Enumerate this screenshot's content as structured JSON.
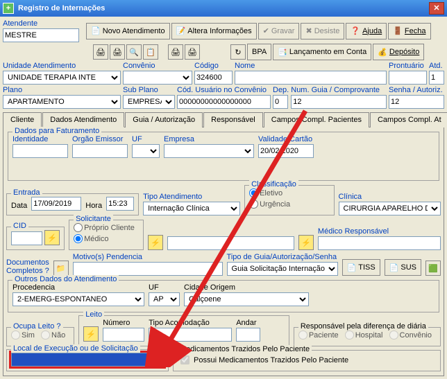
{
  "window": {
    "title": "Registro de Internações"
  },
  "toolbar1": {
    "novo": "Novo Atendimento",
    "altera": "Altera Informações",
    "gravar": "Gravar",
    "desiste": "Desiste",
    "ajuda": "Ajuda",
    "fecha": "Fecha"
  },
  "toolbar2": {
    "bpa": "BPA",
    "lanc": "Lançamento em Conta",
    "deposito": "Depósito"
  },
  "fields": {
    "atendente_label": "Atendente",
    "atendente": "MESTRE",
    "unidade_label": "Unidade Atendimento",
    "unidade": "UNIDADE TERAPIA INTE",
    "convenio_label": "Convênio",
    "codigo_label": "Código",
    "codigo": "324600",
    "nome_label": "Nome",
    "prontuario_label": "Prontuário",
    "atd_label": "Atd.",
    "atd": "1",
    "plano_label": "Plano",
    "plano": "APARTAMENTO",
    "subplano_label": "Sub Plano",
    "subplano": "EMPRESA",
    "codusuario_label": "Cód. Usuário no Convênio",
    "codusuario": "00000000000000000",
    "dep_label": "Dep.",
    "dep": "0",
    "numguia_label": "Num. Guia / Comprovante",
    "numguia": "12",
    "senha_label": "Senha / Autoriz.",
    "senha": "12"
  },
  "tabs": {
    "cliente": "Cliente",
    "dados": "Dados Atendimento",
    "guia": "Guia / Autorização",
    "resp": "Responsável",
    "compp": "Campos Compl. Pacientes",
    "compa": "Campos Compl. At"
  },
  "fat": {
    "legend": "Dados para Faturamento",
    "identidade": "Identidade",
    "orgao": "Orgão Emissor",
    "uf": "UF",
    "empresa": "Empresa",
    "validade": "Validade Cartão",
    "validade_val": "20/02/2020"
  },
  "entrada": {
    "legend": "Entrada",
    "data": "Data",
    "data_val": "17/09/2019",
    "hora": "Hora",
    "hora_val": "15:23"
  },
  "tipoat": {
    "label": "Tipo Atendimento",
    "val": "Internação Clínica"
  },
  "classif": {
    "legend": "Classificação",
    "eletivo": "Eletivo",
    "urgencia": "Urgência"
  },
  "clinica": {
    "label": "Clínica",
    "val": "CIRURGIA APARELHO DI"
  },
  "cid": {
    "legend": "CID"
  },
  "solic": {
    "legend": "Solicitante",
    "proprio": "Próprio Cliente",
    "medico": "Médico"
  },
  "medresp": {
    "label": "Médico Responsável"
  },
  "doccomp": {
    "label": "Documentos\nCompletos ?"
  },
  "motivo": {
    "label": "Motivo(s) Pendencia"
  },
  "tipoguia": {
    "label": "Tipo de Guia/Autorização/Senha",
    "val": "Guia Solicitação Internação"
  },
  "tiss": "TISS",
  "sus": "SUS",
  "outros": {
    "legend": "Outros Dados do Atendimento",
    "proc": "Procedencia",
    "proc_val": "2-EMERG-ESPONTANEO",
    "uf": "UF",
    "uf_val": "AP",
    "cidade": "Cidade Origem",
    "cidade_val": "Calçoene"
  },
  "ocupa": {
    "legend": "Ocupa Leito ?",
    "sim": "Sim",
    "nao": "Não"
  },
  "leito": {
    "legend": "Leito",
    "numero": "Número",
    "tipoac": "Tipo Acomodação",
    "andar": "Andar"
  },
  "respdif": {
    "legend": "Responsável pela diferença de diária",
    "pac": "Paciente",
    "hosp": "Hospital",
    "conv": "Convênio"
  },
  "local": {
    "legend": "Local de Execução ou de Solicitação"
  },
  "meds": {
    "legend": "Medicamentos Trazidos Pelo Paciente",
    "chk": "Possui Medicamentos Trazidos Pelo Paciente"
  }
}
